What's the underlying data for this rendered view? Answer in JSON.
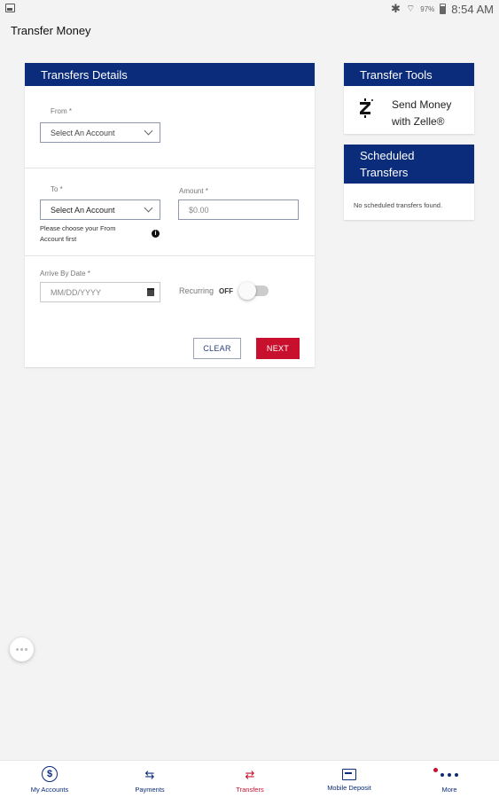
{
  "status_bar": {
    "battery_percent": "97%",
    "time": "8:54 AM",
    "icons": [
      "screenshot-icon",
      "bluetooth-icon",
      "wifi-icon",
      "battery-icon"
    ]
  },
  "header": {
    "title": "Transfer Money"
  },
  "transfer_details": {
    "title": "Transfers Details",
    "from": {
      "label": "From *",
      "value": "Select An Account"
    },
    "to": {
      "label": "To *",
      "value": "Select An Account",
      "help": "Please choose your From Account first"
    },
    "amount": {
      "label": "Amount *",
      "placeholder": "$0.00"
    },
    "arrive_by": {
      "label": "Arrive By Date *",
      "placeholder": "MM/DD/YYYY"
    },
    "recurring": {
      "label": "Recurring",
      "state": "OFF"
    },
    "buttons": {
      "clear": "CLEAR",
      "next": "NEXT"
    }
  },
  "transfer_tools": {
    "title": "Transfer Tools",
    "zelle_line1": "Send Money",
    "zelle_line2": "with Zelle®"
  },
  "scheduled": {
    "title_line1": "Scheduled",
    "title_line2": "Transfers",
    "empty": "No scheduled transfers found."
  },
  "bottom_nav": [
    {
      "label": "My Accounts",
      "icon": "dollar-circle-icon"
    },
    {
      "label": "Payments",
      "icon": "swap-arrows-icon"
    },
    {
      "label": "Transfers",
      "icon": "transfer-arrows-icon",
      "active": true
    },
    {
      "label": "Mobile Deposit",
      "icon": "mobile-deposit-icon"
    },
    {
      "label": "More",
      "icon": "more-dots-icon"
    }
  ],
  "colors": {
    "brand_navy": "#0a2c7b",
    "accent_red": "#c8102e",
    "background": "#f3f3f4"
  }
}
